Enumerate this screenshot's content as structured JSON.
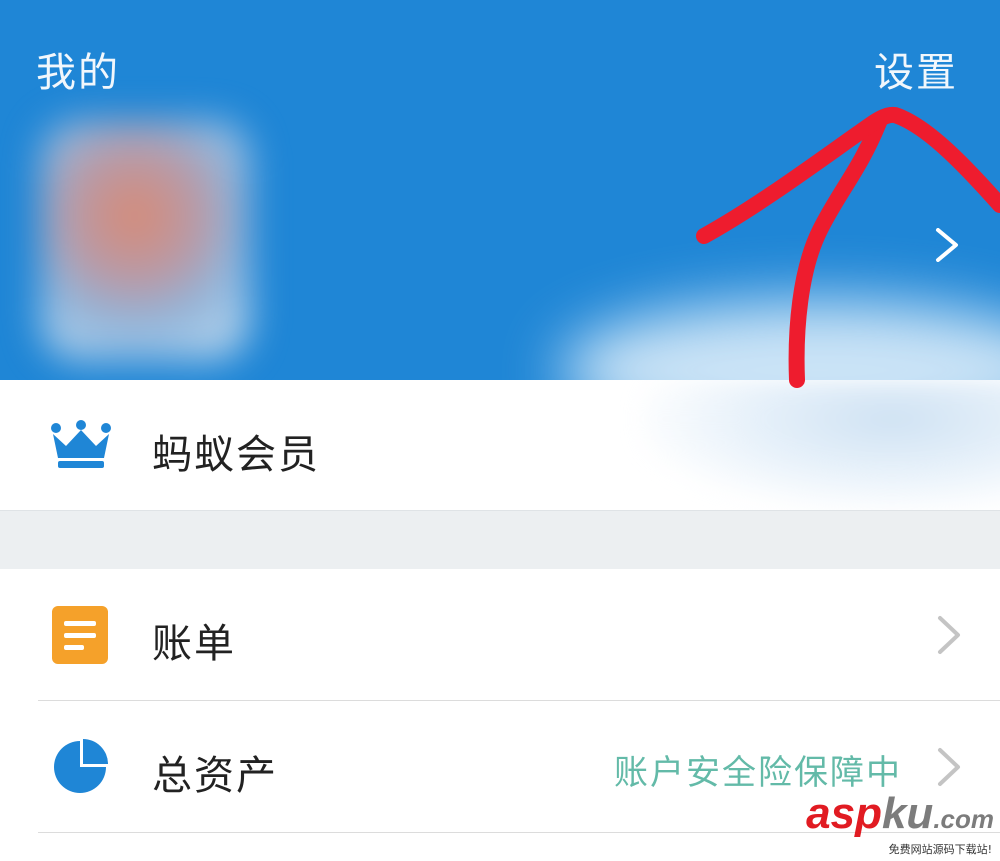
{
  "header": {
    "title": "我的",
    "settings_label": "设置",
    "background_color": "#1f86d6"
  },
  "member": {
    "label": "蚂蚁会员",
    "icon": "crown-icon",
    "icon_color": "#1f86d6"
  },
  "menu": {
    "items": [
      {
        "label": "账单",
        "icon": "bill-icon",
        "icon_color": "#f5a12a",
        "note": ""
      },
      {
        "label": "总资产",
        "icon": "pie-chart-icon",
        "icon_color": "#1f86d6",
        "note": "账户安全险保障中"
      }
    ]
  },
  "annotation": {
    "color": "#ee1c2e",
    "shape": "arrow pointing to settings"
  },
  "watermark": {
    "brand_a": "asp",
    "brand_b": "ku",
    "brand_c": ".com",
    "tagline": "免费网站源码下载站!"
  }
}
